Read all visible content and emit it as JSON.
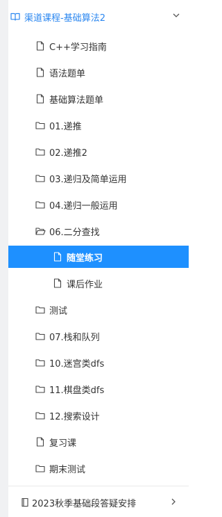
{
  "header": {
    "title": "渠道课程-基础算法2",
    "icon": "book-open-icon",
    "toggle_icon": "chevron-down-icon"
  },
  "items": [
    {
      "label": "C++学习指南",
      "icon": "file-icon"
    },
    {
      "label": "语法题单",
      "icon": "file-icon"
    },
    {
      "label": "基础算法题单",
      "icon": "file-icon"
    },
    {
      "label": "01.递推",
      "icon": "folder-icon"
    },
    {
      "label": "02.递推2",
      "icon": "folder-icon"
    },
    {
      "label": "03.递归及简单运用",
      "icon": "folder-icon"
    },
    {
      "label": "04.递归一般运用",
      "icon": "folder-icon"
    },
    {
      "label": "06.二分查找",
      "icon": "folder-open-icon"
    },
    {
      "label": "随堂练习",
      "icon": "file-icon",
      "active": true
    },
    {
      "label": "课后作业",
      "icon": "file-icon"
    },
    {
      "label": "测试",
      "icon": "folder-icon"
    },
    {
      "label": "07.栈和队列",
      "icon": "folder-icon"
    },
    {
      "label": "10.迷宫类dfs",
      "icon": "folder-icon"
    },
    {
      "label": "11.棋盘类dfs",
      "icon": "folder-icon"
    },
    {
      "label": "12.搜索设计",
      "icon": "folder-icon"
    },
    {
      "label": "复习课",
      "icon": "file-icon"
    },
    {
      "label": "期末测试",
      "icon": "folder-icon"
    }
  ],
  "footer": {
    "title": "2023秋季基础段答疑安排",
    "icon": "book-icon",
    "toggle_icon": "chevron-right-icon"
  },
  "colors": {
    "accent": "#1e90ff",
    "header_text": "#2b87f0",
    "text": "#333333"
  }
}
